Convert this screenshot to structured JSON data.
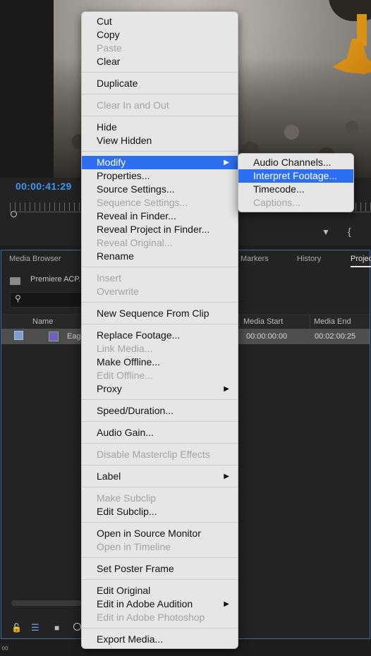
{
  "monitor": {
    "timecode": "00:00:41:29"
  },
  "panel": {
    "tabs": [
      "Media Browser",
      "Markers",
      "History",
      "Projec"
    ],
    "project_name": "Premiere ACP.p",
    "columns": [
      "Name",
      "Media Start",
      "Media End"
    ],
    "row": {
      "name": "Eagl",
      "media_start": "00:00:00:00",
      "media_end": "00:02:00:25"
    }
  },
  "context_menu": {
    "groups": [
      [
        "Cut",
        "Copy",
        "Paste",
        "Clear"
      ],
      [
        "Duplicate"
      ],
      [
        "Clear In and Out"
      ],
      [
        "Hide",
        "View Hidden"
      ],
      [
        "Modify",
        "Properties...",
        "Source Settings...",
        "Sequence Settings...",
        "Reveal in Finder...",
        "Reveal Project in Finder...",
        "Reveal Original...",
        "Rename"
      ],
      [
        "Insert",
        "Overwrite"
      ],
      [
        "New Sequence From Clip"
      ],
      [
        "Replace Footage...",
        "Link Media...",
        "Make Offline...",
        "Edit Offline...",
        "Proxy"
      ],
      [
        "Speed/Duration..."
      ],
      [
        "Audio Gain..."
      ],
      [
        "Disable Masterclip Effects"
      ],
      [
        "Label"
      ],
      [
        "Make Subclip",
        "Edit Subclip..."
      ],
      [
        "Open in Source Monitor",
        "Open in Timeline"
      ],
      [
        "Set Poster Frame"
      ],
      [
        "Edit Original",
        "Edit in Adobe Audition",
        "Edit in Adobe Photoshop"
      ],
      [
        "Export Media..."
      ]
    ],
    "disabled": [
      "Paste",
      "Clear In and Out",
      "Sequence Settings...",
      "Reveal Original...",
      "Insert",
      "Overwrite",
      "Link Media...",
      "Edit Offline...",
      "Disable Masterclip Effects",
      "Make Subclip",
      "Open in Timeline",
      "Edit in Adobe Photoshop"
    ],
    "submenu_items": [
      "Modify",
      "Proxy",
      "Label",
      "Edit in Adobe Audition"
    ],
    "highlighted": "Modify"
  },
  "submenu": {
    "items": [
      "Audio Channels...",
      "Interpret Footage...",
      "Timecode...",
      "Captions..."
    ],
    "disabled": [
      "Captions..."
    ],
    "highlighted": "Interpret Footage..."
  },
  "colors": {
    "accent": "#2d6ff0",
    "timecode": "#3f96f0",
    "panel_border": "#3a6ea5"
  }
}
